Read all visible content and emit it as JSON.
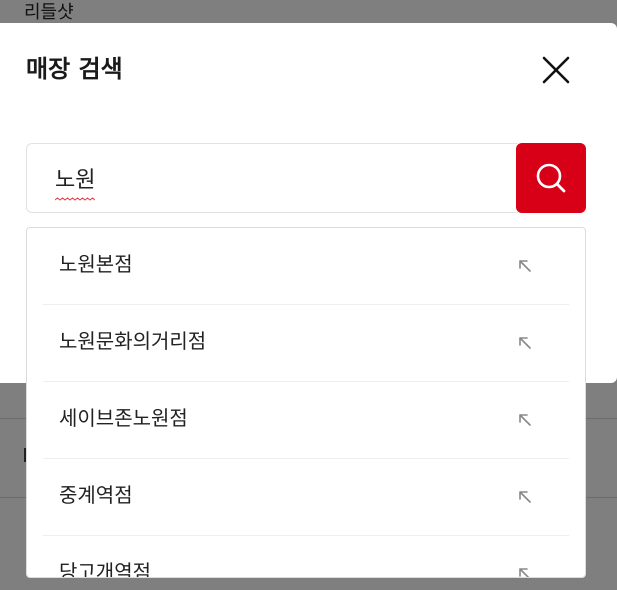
{
  "brand": "리들샷",
  "modal": {
    "title": "매장 검색",
    "close_icon": "close-icon"
  },
  "search": {
    "value": "노원",
    "button_icon": "search-icon"
  },
  "suggestions": [
    {
      "label": "노원본점",
      "icon": "arrow-up-left-icon"
    },
    {
      "label": "노원문화의거리점",
      "icon": "arrow-up-left-icon"
    },
    {
      "label": "세이브존노원점",
      "icon": "arrow-up-left-icon"
    },
    {
      "label": "중계역점",
      "icon": "arrow-up-left-icon"
    },
    {
      "label": "당고개역점",
      "icon": "arrow-up-left-icon"
    }
  ],
  "colors": {
    "accent": "#d70016",
    "overlay": "rgba(0,0,0,0.5)"
  }
}
